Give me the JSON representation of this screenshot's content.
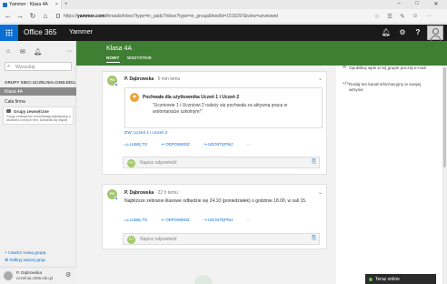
{
  "browser": {
    "tab_title": "Yammer : Klasa 4A",
    "url_prefix": "https://",
    "url_host": "yammer.com",
    "url_path": "/threads/inbox?type=in_pads?inbox?type=in_group&feedId=1516297&view=unviewed"
  },
  "o365": {
    "suite_name": "Office 365",
    "app_name": "Yammer"
  },
  "sidebar": {
    "search_placeholder": "Wyszukaj",
    "groups_header": "GRUPY SIECI UCZELNIA.O365.EDU...",
    "groups": [
      {
        "label": "Klasa 4A"
      },
      {
        "label": "Cała firma"
      }
    ],
    "notice_title": "Grupy zewnętrzne",
    "notice_text": "Grupy zewnętrzne umożliwiają współpracę z osobami z innych firm. Dowiedz się więcej",
    "create_group": "Utwórz nową grupę",
    "discover_group": "Odkryj więcej grup",
    "user_name": "P. Dąbrowska",
    "user_email": "uczelnia.o365.edu.pl"
  },
  "group": {
    "name": "Klasa 4A",
    "tabs": [
      {
        "label": "NOWY"
      },
      {
        "label": "WSZYSTKIE"
      }
    ]
  },
  "posts": [
    {
      "initials": "PD",
      "author": "P. Dąbrowska",
      "time": " · 5 min temu",
      "praise_title": "Pochwała dla użytkownika Uczeń 1 i Uczeń 2",
      "praise_quote": "\"Uczniowie 1 i Uczniowi 2 należy się pochwała za aktywną pracę w wolontariacie szkolnym!\"",
      "cc": "DW: Uczeń 1 i Uczeń 2",
      "like": "LUBIĘ TO",
      "reply": "ODPOWIEDZ",
      "share": "UDOSTĘPNIJ",
      "more": "···",
      "reply_placeholder": "Napisz odpowiedź"
    },
    {
      "initials": "PD",
      "author": "P. Dąbrowska",
      "time": " · 22 h temu",
      "body": "Najbliższe zebranie klasowe odbędzie się 24.10 (poniedziałek) o godzinie 18.00, w sali 15.",
      "like": "LUBIĘ TO",
      "reply": "ODPOWIEDZ",
      "share": "UDOSTĘPNIJ",
      "more": "···",
      "reply_placeholder": "Napisz odpowiedź"
    }
  ],
  "right_panel": {
    "links": [
      {
        "label": "Opublikuj wpis w tej grupie pocztą e-mail"
      },
      {
        "label": "Dodaj ten kanał informacyjny w swojej witrynie"
      }
    ]
  },
  "chat": {
    "label": "Teraz online"
  },
  "colors": {
    "group_header": "#3f7f33",
    "o365_bar": "#1a1a1a",
    "waffle": "#0a6ed1",
    "link": "#0a6ed1"
  }
}
